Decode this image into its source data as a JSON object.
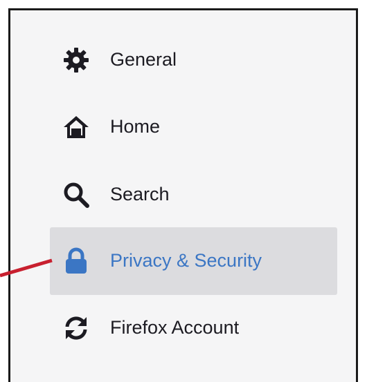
{
  "sidebar": {
    "items": [
      {
        "label": "General",
        "icon": "gear-icon",
        "selected": false
      },
      {
        "label": "Home",
        "icon": "home-icon",
        "selected": false
      },
      {
        "label": "Search",
        "icon": "search-icon",
        "selected": false
      },
      {
        "label": "Privacy & Security",
        "icon": "lock-icon",
        "selected": true
      },
      {
        "label": "Firefox Account",
        "icon": "sync-icon",
        "selected": false
      }
    ]
  },
  "colors": {
    "panel_background": "#f5f5f6",
    "selected_background": "#dcdcdf",
    "selected_text": "#3b76c4",
    "text": "#1c1b22",
    "callout": "#c8202f"
  }
}
